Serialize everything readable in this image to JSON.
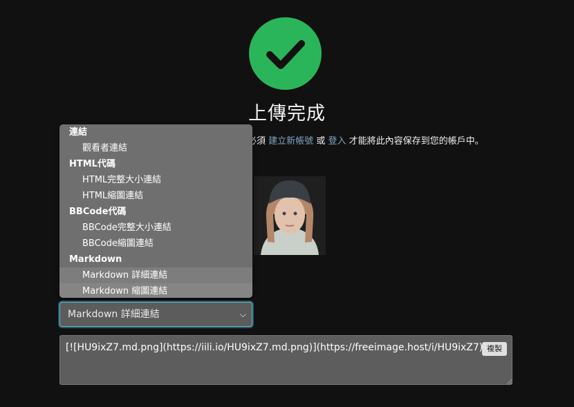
{
  "status": {
    "title": "上傳完成",
    "notice_prefix": "必須",
    "register_link": "建立新帳號",
    "or_text": "或",
    "login_link": "登入",
    "notice_suffix": "才能將此內容保存到您的帳戶中。"
  },
  "dropdown": {
    "groups": [
      {
        "label": "連結",
        "options": [
          "觀看者連結"
        ]
      },
      {
        "label": "HTML代碼",
        "options": [
          "HTML完整大小連結",
          "HTML縮圖連結"
        ]
      },
      {
        "label": "BBCode代碼",
        "options": [
          "BBCode完整大小連結",
          "BBCode縮圖連結"
        ]
      },
      {
        "label": "Markdown",
        "options": [
          "Markdown 詳細連結",
          "Markdown 縮圖連結"
        ]
      }
    ]
  },
  "select": {
    "value": "Markdown 詳細連結"
  },
  "code": {
    "text": "[![HU9ixZ7.md.png](https://iili.io/HU9ixZ7.md.png)](https://freeimage.host/i/HU9ixZ7)"
  },
  "copy_button": {
    "label": "複製"
  },
  "colors": {
    "success": "#2bb55a",
    "link": "#7fa3bf",
    "background": "#111111"
  }
}
